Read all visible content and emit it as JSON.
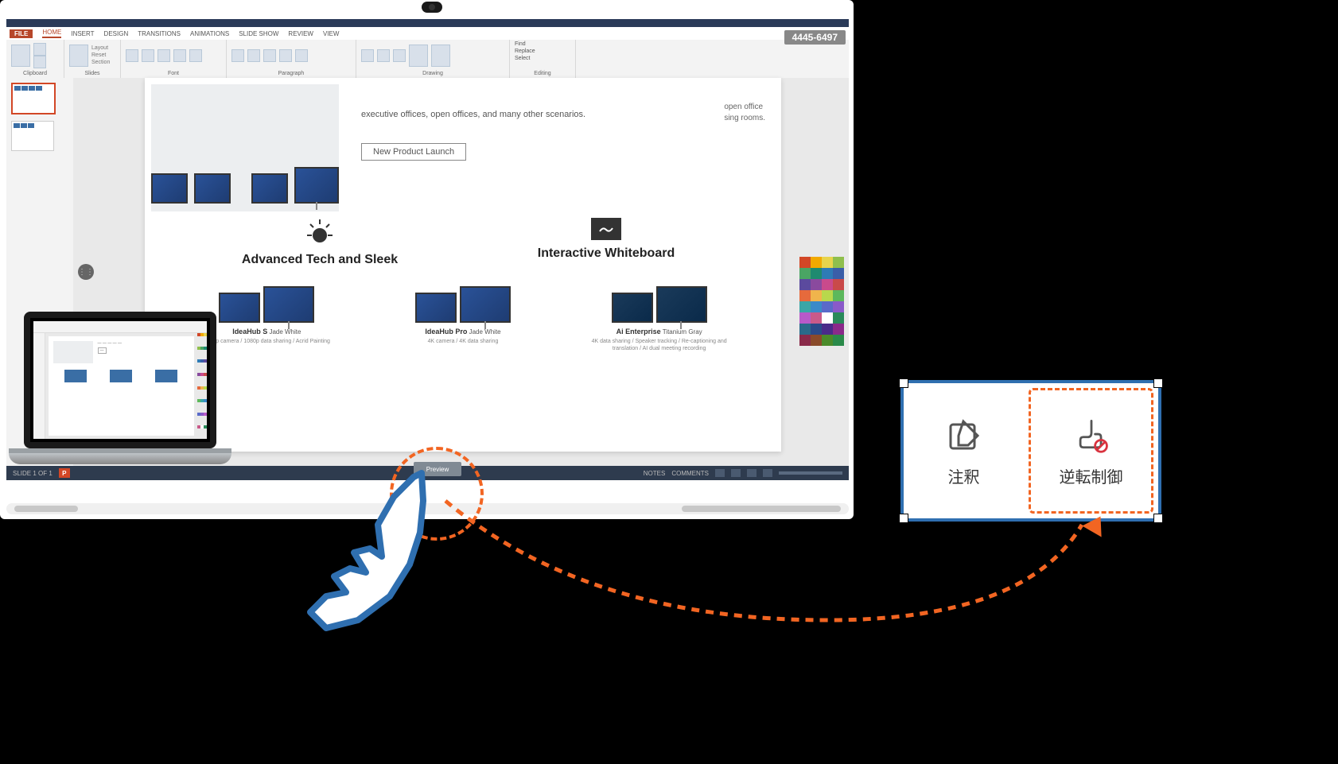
{
  "timestamp": "4445-6497",
  "ribbon": {
    "tabs": [
      "FILE",
      "HOME",
      "INSERT",
      "DESIGN",
      "TRANSITIONS",
      "ANIMATIONS",
      "SLIDE SHOW",
      "REVIEW",
      "VIEW"
    ],
    "groups": [
      "Clipboard",
      "Slides",
      "Font",
      "Paragraph",
      "Drawing",
      "Editing"
    ],
    "editing": {
      "find": "Find",
      "replace": "Replace",
      "select": "Select"
    }
  },
  "slide": {
    "float_text_1": "open office",
    "float_text_2": "sing rooms.",
    "body": "executive offices, open offices, and many other scenarios.",
    "button": "New Product Launch",
    "feature1": "Advanced Tech and Sleek",
    "feature2": "Interactive Whiteboard",
    "products": [
      {
        "name": "IdeaHub S",
        "variant": "Jade White",
        "sub": "1080p camera / 1080p data sharing / Acrid Painting"
      },
      {
        "name": "IdeaHub Pro",
        "variant": "Jade White",
        "sub": "4K camera / 4K data sharing"
      },
      {
        "name": "Ai Enterprise",
        "variant": "Titanium Gray",
        "sub": "4K data sharing / Speaker tracking / Re-captioning and translation / AI dual meeting recording"
      }
    ]
  },
  "footer": {
    "notes": "NOTES",
    "comments": "COMMENTS"
  },
  "floating_button": "Preview",
  "palette": [
    "#d24726",
    "#f2a900",
    "#e8d44c",
    "#8fbf4d",
    "#4aa564",
    "#1f8a70",
    "#2e7bb6",
    "#3a5ea8",
    "#5b4a9e",
    "#8a4a9e",
    "#c94a8c",
    "#c94a4a",
    "#e66a3c",
    "#f0b44c",
    "#b8d84c",
    "#5cb85c",
    "#3aa6a6",
    "#3a8ac9",
    "#5a6ac9",
    "#8a5ac9",
    "#b85ac9",
    "#c95a8a",
    "#ffffff",
    "#2a8a5a",
    "#2a6a8a",
    "#2a4a8a",
    "#4a2a8a",
    "#8a2a8a",
    "#8a2a4a",
    "#8a4a2a",
    "#4a8a2a",
    "#2a8a4a"
  ],
  "callout": {
    "annotate": "注釈",
    "reverse_control": "逆転制御"
  }
}
